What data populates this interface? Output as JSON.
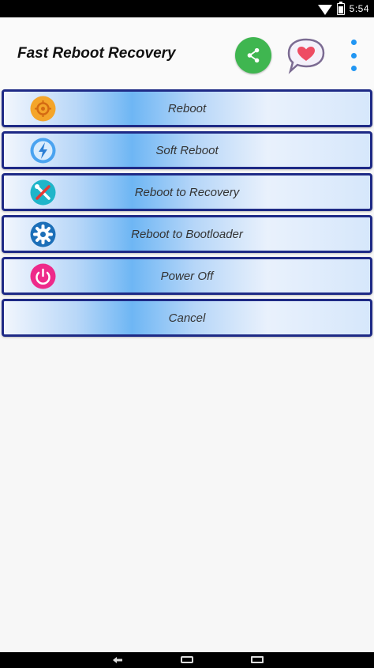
{
  "status_bar": {
    "time": "5:54",
    "icons": [
      "wifi-icon",
      "battery-icon"
    ]
  },
  "app_bar": {
    "title": "Fast Reboot Recovery",
    "actions": [
      "share-icon",
      "rate-heart-icon",
      "overflow-menu-icon"
    ],
    "colors": {
      "share": "#3fb650",
      "overflow": "#2196f3"
    }
  },
  "menu": {
    "items": [
      {
        "label": "Reboot",
        "icon": "reboot-icon",
        "icon_color": "#f4a52a"
      },
      {
        "label": "Soft Reboot",
        "icon": "lightning-icon",
        "icon_color": "#4aa3f0"
      },
      {
        "label": "Reboot to Recovery",
        "icon": "tools-icon",
        "icon_color": "#1fb5c9"
      },
      {
        "label": "Reboot to Bootloader",
        "icon": "gear-icon",
        "icon_color": "#1c6fb8"
      },
      {
        "label": "Power Off",
        "icon": "power-icon",
        "icon_color": "#ee2a8a"
      },
      {
        "label": "Cancel"
      }
    ],
    "border_color": "#1e2a86"
  },
  "nav_bar": {
    "buttons": [
      "back-icon",
      "home-icon",
      "recents-icon"
    ]
  }
}
